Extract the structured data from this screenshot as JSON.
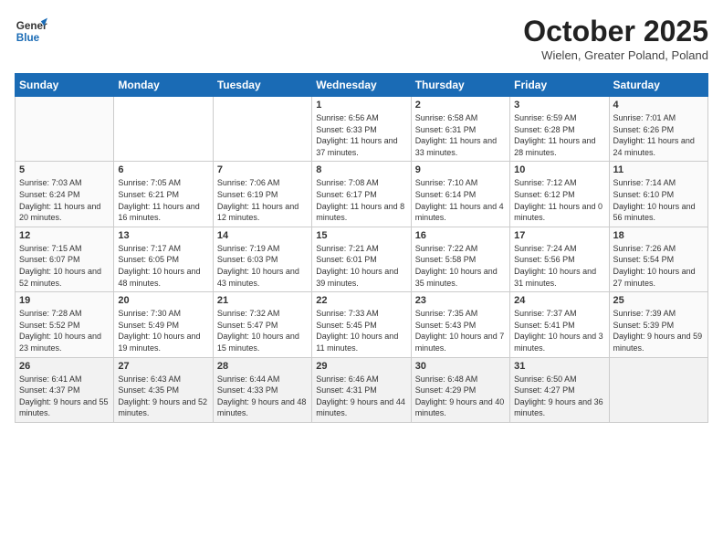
{
  "header": {
    "logo_general": "General",
    "logo_blue": "Blue",
    "month_title": "October 2025",
    "location": "Wielen, Greater Poland, Poland"
  },
  "days_of_week": [
    "Sunday",
    "Monday",
    "Tuesday",
    "Wednesday",
    "Thursday",
    "Friday",
    "Saturday"
  ],
  "weeks": [
    [
      {
        "num": "",
        "info": ""
      },
      {
        "num": "",
        "info": ""
      },
      {
        "num": "",
        "info": ""
      },
      {
        "num": "1",
        "info": "Sunrise: 6:56 AM\nSunset: 6:33 PM\nDaylight: 11 hours and 37 minutes."
      },
      {
        "num": "2",
        "info": "Sunrise: 6:58 AM\nSunset: 6:31 PM\nDaylight: 11 hours and 33 minutes."
      },
      {
        "num": "3",
        "info": "Sunrise: 6:59 AM\nSunset: 6:28 PM\nDaylight: 11 hours and 28 minutes."
      },
      {
        "num": "4",
        "info": "Sunrise: 7:01 AM\nSunset: 6:26 PM\nDaylight: 11 hours and 24 minutes."
      }
    ],
    [
      {
        "num": "5",
        "info": "Sunrise: 7:03 AM\nSunset: 6:24 PM\nDaylight: 11 hours and 20 minutes."
      },
      {
        "num": "6",
        "info": "Sunrise: 7:05 AM\nSunset: 6:21 PM\nDaylight: 11 hours and 16 minutes."
      },
      {
        "num": "7",
        "info": "Sunrise: 7:06 AM\nSunset: 6:19 PM\nDaylight: 11 hours and 12 minutes."
      },
      {
        "num": "8",
        "info": "Sunrise: 7:08 AM\nSunset: 6:17 PM\nDaylight: 11 hours and 8 minutes."
      },
      {
        "num": "9",
        "info": "Sunrise: 7:10 AM\nSunset: 6:14 PM\nDaylight: 11 hours and 4 minutes."
      },
      {
        "num": "10",
        "info": "Sunrise: 7:12 AM\nSunset: 6:12 PM\nDaylight: 11 hours and 0 minutes."
      },
      {
        "num": "11",
        "info": "Sunrise: 7:14 AM\nSunset: 6:10 PM\nDaylight: 10 hours and 56 minutes."
      }
    ],
    [
      {
        "num": "12",
        "info": "Sunrise: 7:15 AM\nSunset: 6:07 PM\nDaylight: 10 hours and 52 minutes."
      },
      {
        "num": "13",
        "info": "Sunrise: 7:17 AM\nSunset: 6:05 PM\nDaylight: 10 hours and 48 minutes."
      },
      {
        "num": "14",
        "info": "Sunrise: 7:19 AM\nSunset: 6:03 PM\nDaylight: 10 hours and 43 minutes."
      },
      {
        "num": "15",
        "info": "Sunrise: 7:21 AM\nSunset: 6:01 PM\nDaylight: 10 hours and 39 minutes."
      },
      {
        "num": "16",
        "info": "Sunrise: 7:22 AM\nSunset: 5:58 PM\nDaylight: 10 hours and 35 minutes."
      },
      {
        "num": "17",
        "info": "Sunrise: 7:24 AM\nSunset: 5:56 PM\nDaylight: 10 hours and 31 minutes."
      },
      {
        "num": "18",
        "info": "Sunrise: 7:26 AM\nSunset: 5:54 PM\nDaylight: 10 hours and 27 minutes."
      }
    ],
    [
      {
        "num": "19",
        "info": "Sunrise: 7:28 AM\nSunset: 5:52 PM\nDaylight: 10 hours and 23 minutes."
      },
      {
        "num": "20",
        "info": "Sunrise: 7:30 AM\nSunset: 5:49 PM\nDaylight: 10 hours and 19 minutes."
      },
      {
        "num": "21",
        "info": "Sunrise: 7:32 AM\nSunset: 5:47 PM\nDaylight: 10 hours and 15 minutes."
      },
      {
        "num": "22",
        "info": "Sunrise: 7:33 AM\nSunset: 5:45 PM\nDaylight: 10 hours and 11 minutes."
      },
      {
        "num": "23",
        "info": "Sunrise: 7:35 AM\nSunset: 5:43 PM\nDaylight: 10 hours and 7 minutes."
      },
      {
        "num": "24",
        "info": "Sunrise: 7:37 AM\nSunset: 5:41 PM\nDaylight: 10 hours and 3 minutes."
      },
      {
        "num": "25",
        "info": "Sunrise: 7:39 AM\nSunset: 5:39 PM\nDaylight: 9 hours and 59 minutes."
      }
    ],
    [
      {
        "num": "26",
        "info": "Sunrise: 6:41 AM\nSunset: 4:37 PM\nDaylight: 9 hours and 55 minutes."
      },
      {
        "num": "27",
        "info": "Sunrise: 6:43 AM\nSunset: 4:35 PM\nDaylight: 9 hours and 52 minutes."
      },
      {
        "num": "28",
        "info": "Sunrise: 6:44 AM\nSunset: 4:33 PM\nDaylight: 9 hours and 48 minutes."
      },
      {
        "num": "29",
        "info": "Sunrise: 6:46 AM\nSunset: 4:31 PM\nDaylight: 9 hours and 44 minutes."
      },
      {
        "num": "30",
        "info": "Sunrise: 6:48 AM\nSunset: 4:29 PM\nDaylight: 9 hours and 40 minutes."
      },
      {
        "num": "31",
        "info": "Sunrise: 6:50 AM\nSunset: 4:27 PM\nDaylight: 9 hours and 36 minutes."
      },
      {
        "num": "",
        "info": ""
      }
    ]
  ]
}
